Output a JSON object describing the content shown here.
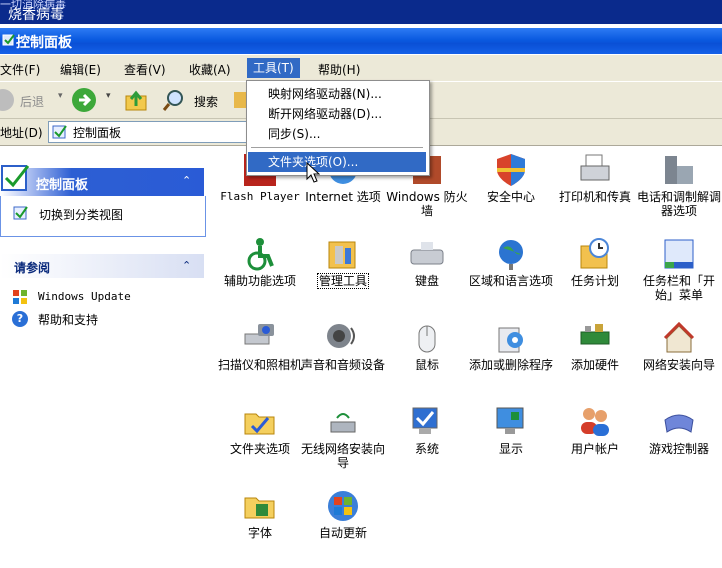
{
  "top_strip": {
    "line1": "一切消除病毒",
    "line2": "烧香病毒"
  },
  "window": {
    "title": "控制面板"
  },
  "menu": {
    "file": "文件(F)",
    "edit": "编辑(E)",
    "view": "查看(V)",
    "favorites": "收藏(A)",
    "tools": "工具(T)",
    "help": "帮助(H)"
  },
  "toolbar": {
    "back": "后退",
    "search": "搜索"
  },
  "address": {
    "label": "地址(D)",
    "value": "控制面板"
  },
  "tools_menu": {
    "items": [
      "映射网络驱动器(N)...",
      "断开网络驱动器(D)...",
      "同步(S)...",
      "文件夹选项(O)..."
    ],
    "highlighted_index": 3
  },
  "left": {
    "control_panel": {
      "title": "控制面板",
      "switch_link": "切换到分类视图"
    },
    "see_also": {
      "title": "请参阅",
      "links": [
        "Windows Update",
        "帮助和支持"
      ]
    }
  },
  "items": [
    {
      "label": "Flash Player",
      "icon": "flash-icon"
    },
    {
      "label": "Internet 选项",
      "icon": "internet-options-icon"
    },
    {
      "label": "Windows 防火墙",
      "icon": "firewall-icon"
    },
    {
      "label": "安全中心",
      "icon": "security-center-icon"
    },
    {
      "label": "打印机和传真",
      "icon": "printer-icon"
    },
    {
      "label": "电话和调制解调器选项",
      "icon": "phone-modem-icon"
    },
    {
      "label": "辅助功能选项",
      "icon": "accessibility-icon"
    },
    {
      "label": "管理工具",
      "icon": "admin-tools-icon"
    },
    {
      "label": "键盘",
      "icon": "keyboard-icon"
    },
    {
      "label": "区域和语言选项",
      "icon": "globe-icon"
    },
    {
      "label": "任务计划",
      "icon": "task-scheduler-icon"
    },
    {
      "label": "任务栏和「开始」菜单",
      "icon": "taskbar-icon"
    },
    {
      "label": "扫描仪和照相机",
      "icon": "scanner-camera-icon"
    },
    {
      "label": "声音和音频设备",
      "icon": "speaker-icon"
    },
    {
      "label": "鼠标",
      "icon": "mouse-icon"
    },
    {
      "label": "添加或删除程序",
      "icon": "add-remove-icon"
    },
    {
      "label": "添加硬件",
      "icon": "add-hardware-icon"
    },
    {
      "label": "网络安装向导",
      "icon": "network-setup-icon"
    },
    {
      "label": "文件夹选项",
      "icon": "folder-options-icon"
    },
    {
      "label": "无线网络安装向导",
      "icon": "wireless-icon"
    },
    {
      "label": "系统",
      "icon": "system-icon"
    },
    {
      "label": "显示",
      "icon": "display-icon"
    },
    {
      "label": "用户帐户",
      "icon": "user-accounts-icon"
    },
    {
      "label": "游戏控制器",
      "icon": "game-controller-icon"
    },
    {
      "label": "字体",
      "icon": "fonts-icon"
    },
    {
      "label": "自动更新",
      "icon": "auto-update-icon"
    }
  ]
}
